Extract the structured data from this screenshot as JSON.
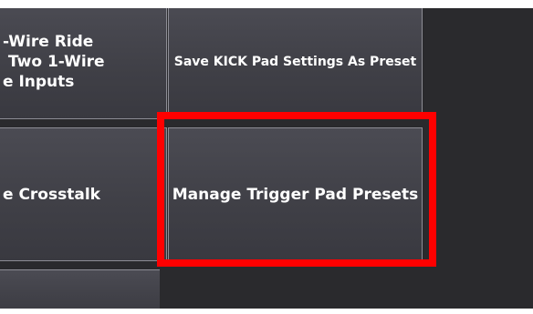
{
  "tiles": {
    "left_top_label": "-Wire Ride\n Two 1-Wire\ne Inputs",
    "left_middle_label": "e Crosstalk",
    "save_preset_label": "Save KICK Pad Settings As Preset",
    "manage_presets_label": "Manage Trigger Pad Presets"
  },
  "highlight": {
    "color": "#ff0000",
    "target": "manage-trigger-pad-presets-button"
  },
  "colors": {
    "background": "#2a2a2d",
    "tile": "#44444b",
    "tile_border": "#8d8d95",
    "text": "#ffffff"
  }
}
